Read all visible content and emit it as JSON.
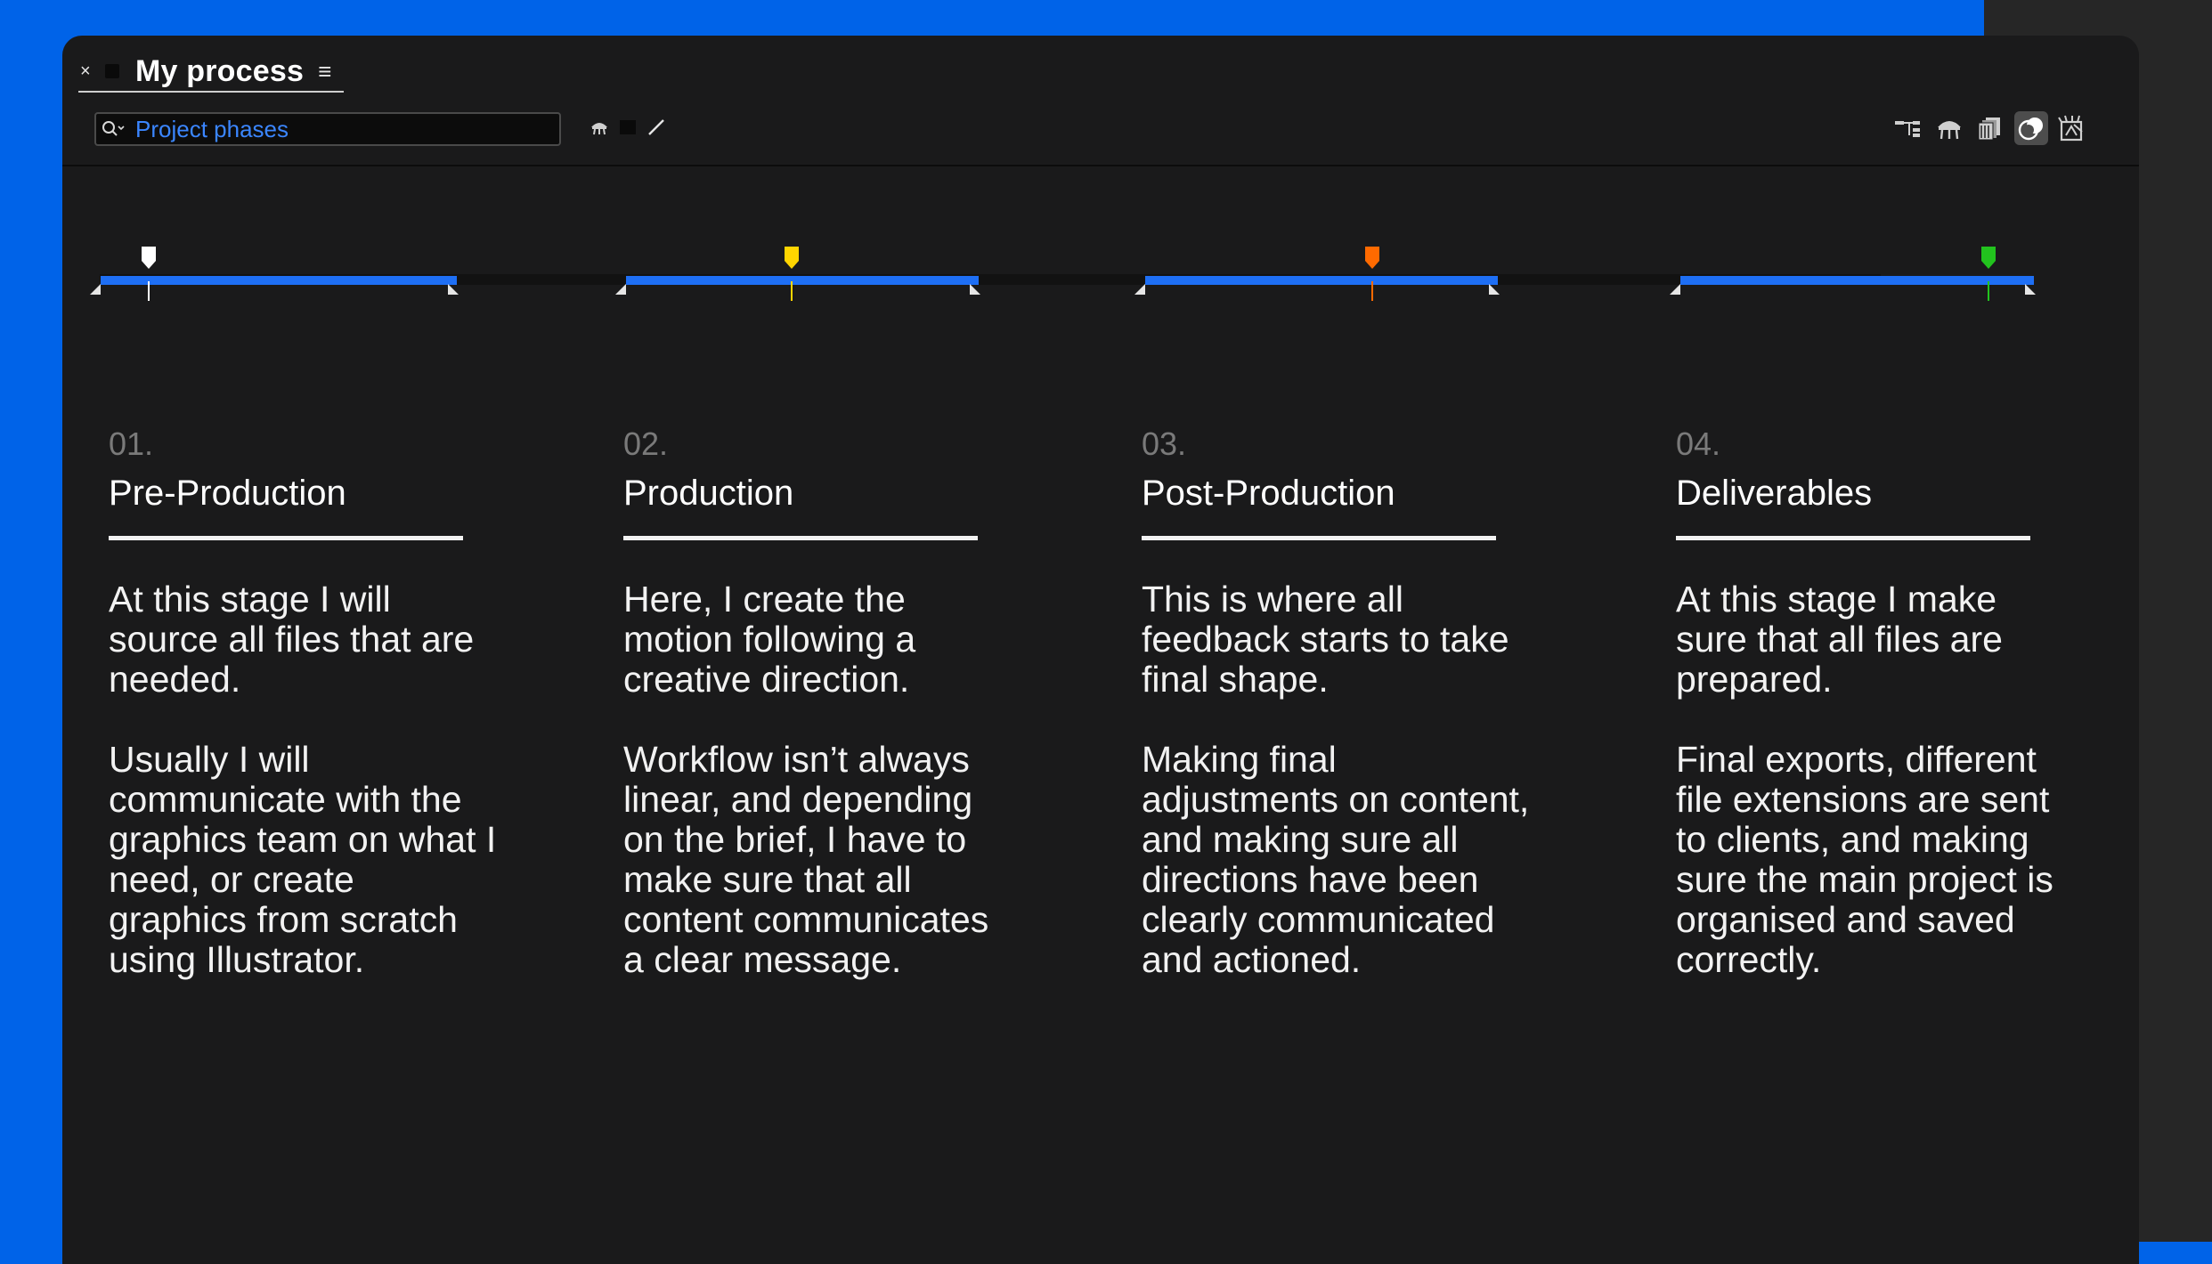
{
  "window": {
    "close_glyph": "×",
    "title": "My process",
    "menu_glyph": "≡"
  },
  "search": {
    "placeholder": "Project phases",
    "icon": "search-icon"
  },
  "toolbar_icons": [
    "shy-layers-icon",
    "frame-blend-icon",
    "motion-blur-icon",
    "graph-editor-icon"
  ],
  "header_icons": [
    "parent-link-icon",
    "shy-toggle-icon",
    "layers-stack-icon",
    "mask-overlay-icon",
    "draft-3d-icon"
  ],
  "colors": {
    "accent": "#0063e8",
    "bar": "#1e6ff5",
    "panel": "#1a1a1b",
    "marker_1": "#ffffff",
    "marker_2": "#ffd500",
    "marker_3": "#ff6a00",
    "marker_4": "#22c31e"
  },
  "phases": [
    {
      "number": "01.",
      "title": "Pre-Production",
      "marker_color": "#ffffff",
      "paragraph_1": "At this stage I will source all files that are needed.",
      "paragraph_2": "Usually I will communicate with the graphics team on what I need, or create graphics from scratch using Illustrator."
    },
    {
      "number": "02.",
      "title": "Production",
      "marker_color": "#ffd500",
      "paragraph_1": "Here, I create the motion following a creative direction.",
      "paragraph_2": "Workflow isn’t always linear, and depending on the brief, I have to make sure that all content communicates a clear message."
    },
    {
      "number": "03.",
      "title": "Post-Production",
      "marker_color": "#ff6a00",
      "paragraph_1": "This is where all feedback starts to take final shape.",
      "paragraph_2": "Making final adjustments on content, and making sure all directions have been clearly communicated and actioned."
    },
    {
      "number": "04.",
      "title": "Deliverables",
      "marker_color": "#22c31e",
      "paragraph_1": "At this stage I make sure that all files are prepared.",
      "paragraph_2": "Final exports, different file extensions are sent to clients, and making sure the main project is organised and saved correctly."
    }
  ]
}
